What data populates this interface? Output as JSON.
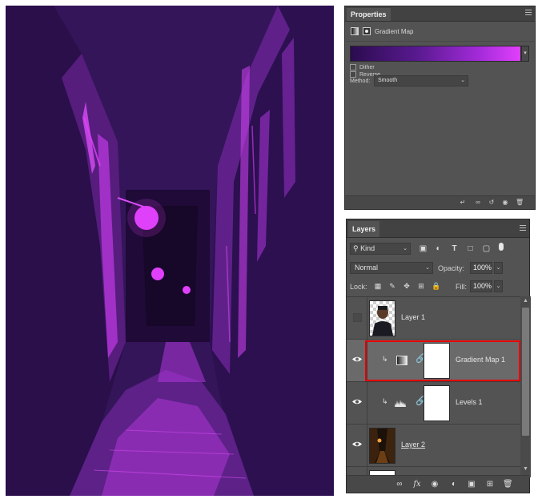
{
  "properties": {
    "tab_label": "Properties",
    "adjustment_name": "Gradient Map",
    "dither_label": "Dither",
    "reverse_label": "Reverse",
    "method_label": "Method:",
    "method_value": "Smooth",
    "gradient_colors": [
      "#2b0c4f",
      "#5a1a91",
      "#a22ad8",
      "#e040fb"
    ],
    "footer_icons": [
      "clip-to-layer-icon",
      "view-previous-state-icon",
      "reset-icon",
      "visibility-eye-icon",
      "trash-icon"
    ]
  },
  "layers": {
    "tab_label": "Layers",
    "filter_kind": "Kind",
    "blend_mode": "Normal",
    "opacity_label": "Opacity:",
    "opacity_value": "100%",
    "lock_label": "Lock:",
    "fill_label": "Fill:",
    "fill_value": "100%",
    "items": [
      {
        "name": "Layer 1",
        "visible": false,
        "type": "pixel"
      },
      {
        "name": "Gradient Map 1",
        "visible": true,
        "type": "gradient-map",
        "selected": true
      },
      {
        "name": "Levels 1",
        "visible": true,
        "type": "levels"
      },
      {
        "name": "Layer 2",
        "visible": true,
        "type": "pixel"
      }
    ],
    "footer_icons": [
      "link-layers-icon",
      "fx-icon",
      "add-mask-icon",
      "new-adjustment-icon",
      "new-group-icon",
      "new-layer-icon",
      "delete-layer-icon"
    ],
    "fx_glyph": "fx"
  },
  "colors": {
    "canvas_background": "#341559",
    "highlight_magenta": "#e040fb",
    "panel_background": "#535353",
    "selection_outline": "#e60000"
  }
}
